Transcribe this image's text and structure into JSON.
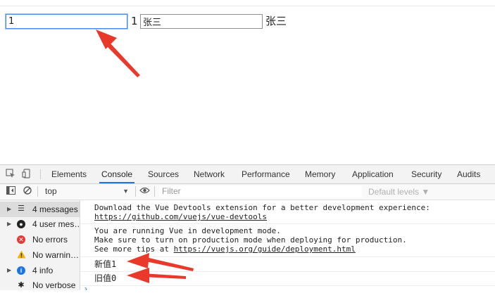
{
  "page": {
    "input1_value": "1",
    "text1": "1",
    "input2_value": "张三",
    "text2": "张三"
  },
  "devtools": {
    "tabs": [
      "Elements",
      "Console",
      "Sources",
      "Network",
      "Performance",
      "Memory",
      "Application",
      "Security",
      "Audits"
    ],
    "active_tab": "Console",
    "context": "top",
    "filter_placeholder": "Filter",
    "levels_label": "Default levels ▼",
    "sidebar": [
      {
        "label": "4 messages",
        "icon": "list-icon"
      },
      {
        "label": "4 user mes…",
        "icon": "user-icon"
      },
      {
        "label": "No errors",
        "icon": "error-icon"
      },
      {
        "label": "No warnin…",
        "icon": "warning-icon"
      },
      {
        "label": "4 info",
        "icon": "info-icon"
      },
      {
        "label": "No verbose",
        "icon": "bug-icon"
      }
    ],
    "messages": {
      "m1_line1": "Download the Vue Devtools extension for a better development experience:",
      "m1_link": "https://github.com/vuejs/vue-devtools",
      "m2_line1": "You are running Vue in development mode.",
      "m2_line2": "Make sure to turn on production mode when deploying for production.",
      "m2_line3_prefix": "See more tips at ",
      "m2_link": "https://vuejs.org/guide/deployment.html",
      "log1": "新值1",
      "log2": "旧值0"
    },
    "prompt": "›"
  },
  "colors": {
    "annotation_arrow": "#e8392b",
    "active_tab_underline": "#1a73e8",
    "error": "#e53935",
    "warning": "#f4b400",
    "info": "#1a73e8"
  }
}
